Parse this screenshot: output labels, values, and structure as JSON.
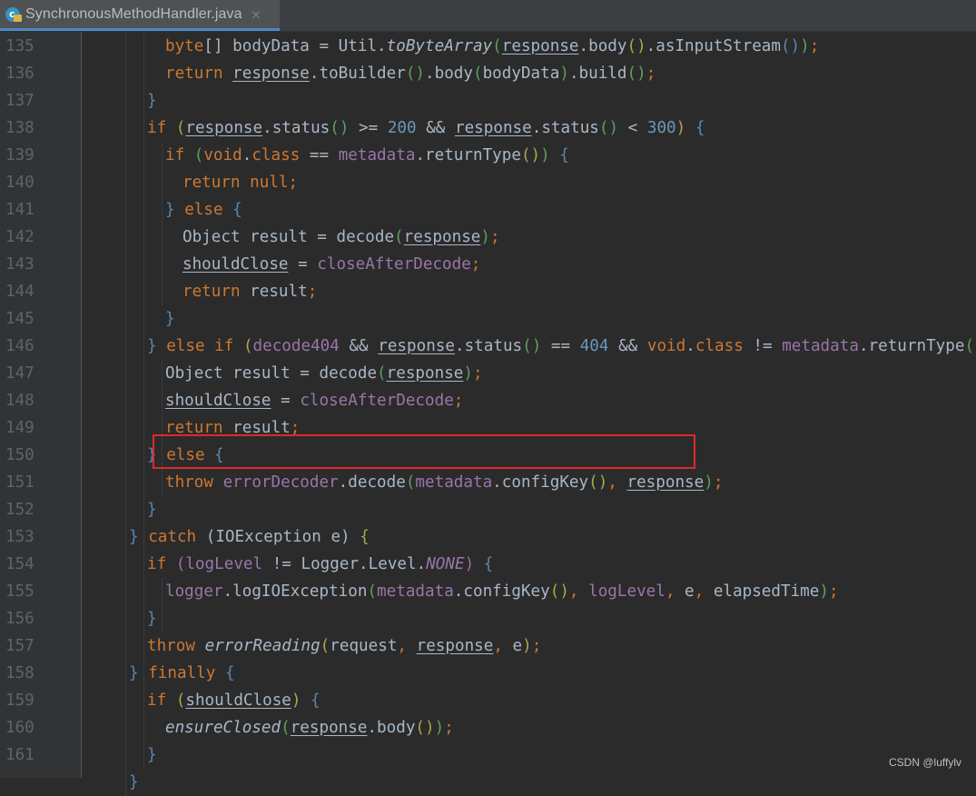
{
  "tab": {
    "title": "SynchronousMethodHandler.java",
    "icon": "java-class-icon",
    "close_glyph": "×"
  },
  "watermark": "CSDN @luffylv",
  "colors": {
    "background": "#2b2b2b",
    "gutter": "#313335",
    "keyword": "#cc7832",
    "number": "#6897bb",
    "field": "#9876aa",
    "text": "#a9b7c6",
    "highlight_border": "#e0282a"
  },
  "code_lines": [
    {
      "n": "135",
      "indent": 9,
      "toks": [
        [
          "byte",
          "kw"
        ],
        [
          "[] bodyData = Util.",
          ""
        ],
        [
          "toByteArray",
          "ital"
        ],
        [
          "(",
          "br-g"
        ],
        [
          "response",
          "ul"
        ],
        [
          ".body",
          ""
        ],
        [
          "()",
          "br-y"
        ],
        [
          ".asInputStream",
          ""
        ],
        [
          "()",
          "br-b"
        ],
        [
          ")",
          "br-g"
        ],
        [
          ";",
          "pun"
        ]
      ]
    },
    {
      "n": "136",
      "indent": 9,
      "toks": [
        [
          "return ",
          "kw"
        ],
        [
          "response",
          "ul"
        ],
        [
          ".toBuilder",
          ""
        ],
        [
          "()",
          "br-g"
        ],
        [
          ".body",
          ""
        ],
        [
          "(",
          "br-g"
        ],
        [
          "bodyData",
          ""
        ],
        [
          ")",
          "br-g"
        ],
        [
          ".build",
          ""
        ],
        [
          "()",
          "br-g"
        ],
        [
          ";",
          "pun"
        ]
      ]
    },
    {
      "n": "137",
      "indent": 8,
      "toks": [
        [
          "}",
          "br-b"
        ]
      ]
    },
    {
      "n": "138",
      "indent": 8,
      "toks": [
        [
          "if ",
          "kw"
        ],
        [
          "(",
          "br-y"
        ],
        [
          "response",
          "ul"
        ],
        [
          ".status",
          ""
        ],
        [
          "()",
          "br-g"
        ],
        [
          " >= ",
          ""
        ],
        [
          "200",
          "num"
        ],
        [
          " && ",
          ""
        ],
        [
          "response",
          "ul"
        ],
        [
          ".status",
          ""
        ],
        [
          "()",
          "br-g"
        ],
        [
          " < ",
          ""
        ],
        [
          "300",
          "num"
        ],
        [
          ")",
          "br-y"
        ],
        [
          " {",
          "br-b"
        ]
      ]
    },
    {
      "n": "139",
      "indent": 9,
      "toks": [
        [
          "if ",
          "kw"
        ],
        [
          "(",
          "br-g"
        ],
        [
          "void",
          "kw"
        ],
        [
          ".",
          ""
        ],
        [
          "class",
          "kw"
        ],
        [
          " == ",
          ""
        ],
        [
          "metadata",
          "fld"
        ],
        [
          ".returnType",
          ""
        ],
        [
          "()",
          "br-y"
        ],
        [
          ")",
          "br-g"
        ],
        [
          " {",
          "br-b"
        ]
      ]
    },
    {
      "n": "140",
      "indent": 10,
      "toks": [
        [
          "return null",
          "kw"
        ],
        [
          ";",
          "pun"
        ]
      ]
    },
    {
      "n": "141",
      "indent": 9,
      "toks": [
        [
          "} ",
          "br-b"
        ],
        [
          "else ",
          "kw"
        ],
        [
          "{",
          "br-b"
        ]
      ]
    },
    {
      "n": "142",
      "indent": 10,
      "toks": [
        [
          "Object result = decode",
          ""
        ],
        [
          "(",
          "br-g"
        ],
        [
          "response",
          "ul"
        ],
        [
          ")",
          "br-g"
        ],
        [
          ";",
          "pun"
        ]
      ]
    },
    {
      "n": "143",
      "indent": 10,
      "toks": [
        [
          "shouldClose",
          "ul"
        ],
        [
          " = ",
          ""
        ],
        [
          "closeAfterDecode",
          "fld"
        ],
        [
          ";",
          "pun"
        ]
      ]
    },
    {
      "n": "144",
      "indent": 10,
      "toks": [
        [
          "return ",
          "kw"
        ],
        [
          "result",
          ""
        ],
        [
          ";",
          "pun"
        ]
      ]
    },
    {
      "n": "145",
      "indent": 9,
      "toks": [
        [
          "}",
          "br-b"
        ]
      ]
    },
    {
      "n": "146",
      "indent": 8,
      "toks": [
        [
          "} ",
          "br-b"
        ],
        [
          "else if ",
          "kw"
        ],
        [
          "(",
          "br-y"
        ],
        [
          "decode404",
          "fld"
        ],
        [
          " && ",
          ""
        ],
        [
          "response",
          "ul"
        ],
        [
          ".status",
          ""
        ],
        [
          "()",
          "br-g"
        ],
        [
          " == ",
          ""
        ],
        [
          "404",
          "num"
        ],
        [
          " && ",
          ""
        ],
        [
          "void",
          "kw"
        ],
        [
          ".",
          ""
        ],
        [
          "class",
          "kw"
        ],
        [
          " != ",
          ""
        ],
        [
          "metadata",
          "fld"
        ],
        [
          ".returnType",
          ""
        ],
        [
          "()",
          "br-g"
        ],
        [
          ")",
          "br-y"
        ],
        [
          " {",
          "br-b"
        ]
      ]
    },
    {
      "n": "147",
      "indent": 9,
      "toks": [
        [
          "Object result = decode",
          ""
        ],
        [
          "(",
          "br-g"
        ],
        [
          "response",
          "ul"
        ],
        [
          ")",
          "br-g"
        ],
        [
          ";",
          "pun"
        ]
      ]
    },
    {
      "n": "148",
      "indent": 9,
      "toks": [
        [
          "shouldClose",
          "ul"
        ],
        [
          " = ",
          ""
        ],
        [
          "closeAfterDecode",
          "fld"
        ],
        [
          ";",
          "pun"
        ]
      ]
    },
    {
      "n": "149",
      "indent": 9,
      "toks": [
        [
          "return ",
          "kw"
        ],
        [
          "result",
          ""
        ],
        [
          ";",
          "pun"
        ]
      ]
    },
    {
      "n": "150",
      "indent": 8,
      "toks": [
        [
          "} ",
          "br-b"
        ],
        [
          "else ",
          "kw"
        ],
        [
          "{",
          "br-b"
        ]
      ]
    },
    {
      "n": "151",
      "indent": 9,
      "toks": [
        [
          "throw ",
          "kw"
        ],
        [
          "errorDecoder",
          "fld"
        ],
        [
          ".decode",
          ""
        ],
        [
          "(",
          "br-g"
        ],
        [
          "metadata",
          "fld"
        ],
        [
          ".configKey",
          ""
        ],
        [
          "()",
          "br-y"
        ],
        [
          ", ",
          "pun"
        ],
        [
          "response",
          "ul"
        ],
        [
          ")",
          "br-g"
        ],
        [
          ";",
          "pun"
        ]
      ]
    },
    {
      "n": "152",
      "indent": 8,
      "toks": [
        [
          "}",
          "br-b"
        ]
      ]
    },
    {
      "n": "153",
      "indent": 7,
      "toks": [
        [
          "} ",
          "br-b"
        ],
        [
          "catch ",
          "kw"
        ],
        [
          "(IOException e) ",
          ""
        ],
        [
          "{",
          "br-y"
        ]
      ]
    },
    {
      "n": "154",
      "indent": 8,
      "toks": [
        [
          "if ",
          "kw"
        ],
        [
          "(",
          "br-p"
        ],
        [
          "logLevel",
          "fld"
        ],
        [
          " != Logger.Level.",
          ""
        ],
        [
          "NONE",
          "fld ital"
        ],
        [
          ")",
          "br-p"
        ],
        [
          " {",
          "br-b"
        ]
      ]
    },
    {
      "n": "155",
      "indent": 9,
      "toks": [
        [
          "logger",
          "fld"
        ],
        [
          ".logIOException",
          ""
        ],
        [
          "(",
          "br-g"
        ],
        [
          "metadata",
          "fld"
        ],
        [
          ".configKey",
          ""
        ],
        [
          "()",
          "br-y"
        ],
        [
          ", ",
          "pun"
        ],
        [
          "logLevel",
          "fld"
        ],
        [
          ", ",
          "pun"
        ],
        [
          "e",
          ""
        ],
        [
          ", ",
          "pun"
        ],
        [
          "elapsedTime",
          ""
        ],
        [
          ")",
          "br-g"
        ],
        [
          ";",
          "pun"
        ]
      ]
    },
    {
      "n": "156",
      "indent": 8,
      "toks": [
        [
          "}",
          "br-b"
        ]
      ]
    },
    {
      "n": "157",
      "indent": 8,
      "toks": [
        [
          "throw ",
          "kw"
        ],
        [
          "errorReading",
          "ital"
        ],
        [
          "(",
          "br-y"
        ],
        [
          "request",
          ""
        ],
        [
          ", ",
          "pun"
        ],
        [
          "response",
          "ul"
        ],
        [
          ", ",
          "pun"
        ],
        [
          "e",
          ""
        ],
        [
          ")",
          "br-y"
        ],
        [
          ";",
          "pun"
        ]
      ]
    },
    {
      "n": "158",
      "indent": 7,
      "toks": [
        [
          "} ",
          "br-b"
        ],
        [
          "finally ",
          "kw"
        ],
        [
          "{",
          "br-b"
        ]
      ]
    },
    {
      "n": "159",
      "indent": 8,
      "toks": [
        [
          "if ",
          "kw"
        ],
        [
          "(",
          "br-y"
        ],
        [
          "shouldClose",
          "ul"
        ],
        [
          ")",
          "br-y"
        ],
        [
          " {",
          "br-b"
        ]
      ]
    },
    {
      "n": "160",
      "indent": 9,
      "toks": [
        [
          "ensureClosed",
          "ital"
        ],
        [
          "(",
          "br-g"
        ],
        [
          "response",
          "ul"
        ],
        [
          ".body",
          ""
        ],
        [
          "()",
          "br-y"
        ],
        [
          ")",
          "br-g"
        ],
        [
          ";",
          "pun"
        ]
      ]
    },
    {
      "n": "161",
      "indent": 8,
      "toks": [
        [
          "}",
          "br-b"
        ]
      ]
    },
    {
      "n": "",
      "indent": 7,
      "toks": [
        [
          "}",
          "br-b"
        ]
      ]
    }
  ]
}
